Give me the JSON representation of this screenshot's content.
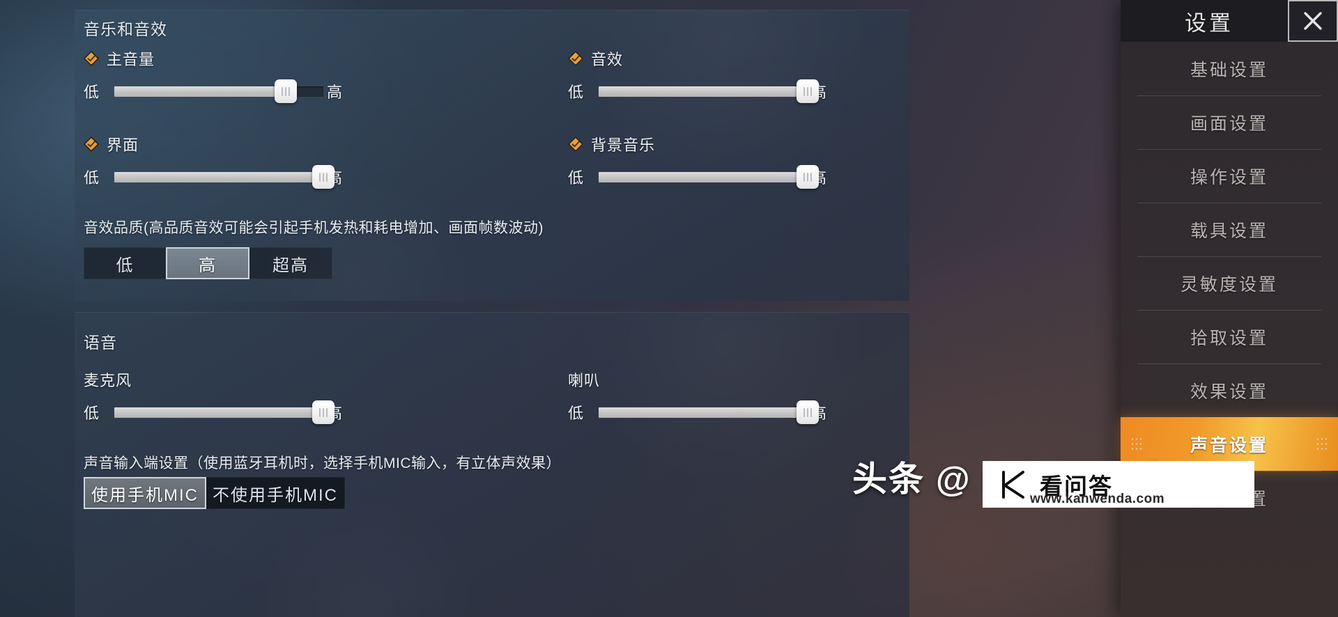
{
  "sidebar": {
    "title": "设置",
    "close_icon": "close-icon",
    "items": [
      {
        "label": "基础设置",
        "active": false
      },
      {
        "label": "画面设置",
        "active": false
      },
      {
        "label": "操作设置",
        "active": false
      },
      {
        "label": "载具设置",
        "active": false
      },
      {
        "label": "灵敏度设置",
        "active": false
      },
      {
        "label": "拾取设置",
        "active": false
      },
      {
        "label": "效果设置",
        "active": false
      },
      {
        "label": "声音设置",
        "active": true
      },
      {
        "label": "录像设置",
        "active": false
      }
    ]
  },
  "audio_section": {
    "title": "音乐和音效",
    "sliders": [
      {
        "name": "主音量",
        "low": "低",
        "high": "高",
        "value": 82,
        "checkbox": true
      },
      {
        "name": "音效",
        "low": "低",
        "high": "高",
        "value": 100,
        "checkbox": true
      },
      {
        "name": "界面",
        "low": "低",
        "high": "高",
        "value": 100,
        "checkbox": true
      },
      {
        "name": "背景音乐",
        "low": "低",
        "high": "高",
        "value": 100,
        "checkbox": true
      }
    ],
    "quality_note": "音效品质(高品质音效可能会引起手机发热和耗电增加、画面帧数波动)",
    "quality_options": [
      "低",
      "高",
      "超高"
    ],
    "quality_selected": "高"
  },
  "voice_section": {
    "title": "语音",
    "sliders": [
      {
        "name": "麦克风",
        "low": "低",
        "high": "高",
        "value": 100
      },
      {
        "name": "喇叭",
        "low": "低",
        "high": "高",
        "value": 100
      }
    ],
    "input_note": "声音输入端设置（使用蓝牙耳机时，选择手机MIC输入，有立体声效果）",
    "input_options": [
      "使用手机MIC",
      "不使用手机MIC"
    ],
    "input_selected": "使用手机MIC"
  },
  "watermark": {
    "handle": "头条 @ msiko 米米",
    "brand_cn": "看问答",
    "brand_url": "www.kanwenda.com"
  },
  "colors": {
    "accent": "#ef8a22",
    "checkbox": "#e8a13a",
    "slider_fill": "#c9c9c9",
    "panel": "#33485c"
  }
}
